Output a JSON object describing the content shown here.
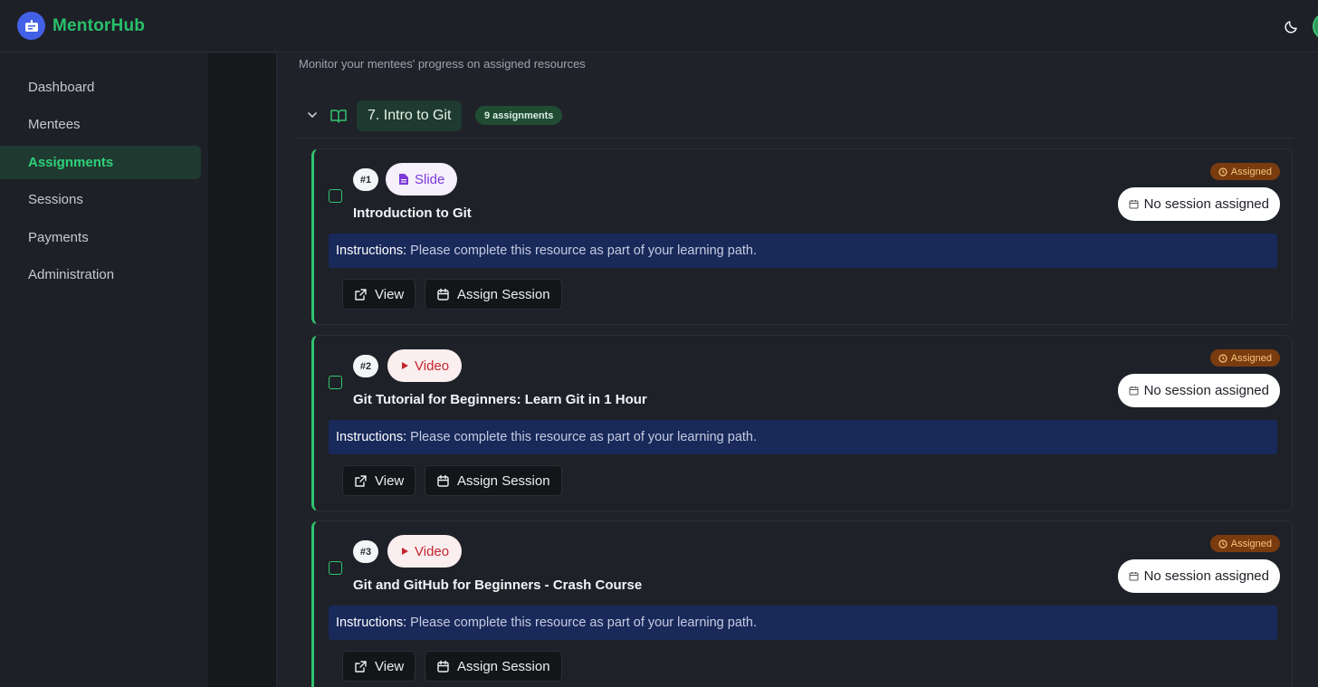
{
  "app": {
    "brand": "MentorHub"
  },
  "sidebar": {
    "items": [
      {
        "label": "Dashboard",
        "active": false
      },
      {
        "label": "Mentees",
        "active": false
      },
      {
        "label": "Assignments",
        "active": true
      },
      {
        "label": "Sessions",
        "active": false
      },
      {
        "label": "Payments",
        "active": false
      },
      {
        "label": "Administration",
        "active": false
      }
    ]
  },
  "main": {
    "subtitle": "Monitor your mentees' progress on assigned resources",
    "group": {
      "title": "7. Intro to Git",
      "count": "9 assignments",
      "expanded": true
    },
    "cards": [
      {
        "number": "#1",
        "type": "Slide",
        "type_icon": "document-icon",
        "title": "Introduction to Git",
        "status": "Assigned",
        "session": "No session assigned",
        "instructions_label": "Instructions:",
        "instructions_text": "Please complete this resource as part of your learning path.",
        "view_label": "View",
        "assign_label": "Assign Session"
      },
      {
        "number": "#2",
        "type": "Video",
        "type_icon": "play-icon",
        "title": "Git Tutorial for Beginners: Learn Git in 1 Hour",
        "status": "Assigned",
        "session": "No session assigned",
        "instructions_label": "Instructions:",
        "instructions_text": "Please complete this resource as part of your learning path.",
        "view_label": "View",
        "assign_label": "Assign Session"
      },
      {
        "number": "#3",
        "type": "Video",
        "type_icon": "play-icon",
        "title": "Git and GitHub for Beginners - Crash Course",
        "status": "Assigned",
        "session": "No session assigned",
        "instructions_label": "Instructions:",
        "instructions_text": "Please complete this resource as part of your learning path.",
        "view_label": "View",
        "assign_label": "Assign Session"
      }
    ]
  },
  "colors": {
    "accent": "#2fc46c",
    "brand": "#29c06b",
    "status_bg": "#7a3b0f",
    "instructions_bg": "#18295a"
  }
}
